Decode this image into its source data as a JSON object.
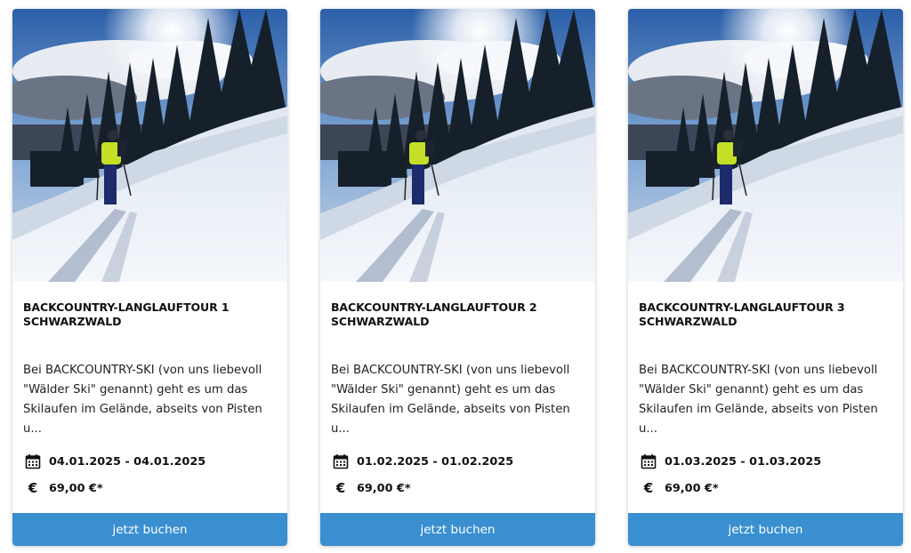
{
  "colors": {
    "button_bg": "#3a8fd0",
    "button_text": "#ffffff",
    "title_text": "#111111"
  },
  "icons": {
    "date": "calendar-icon",
    "price": "euro-icon"
  },
  "cards": [
    {
      "title": "BACKCOUNTRY-LANGLAUFTOUR 1\nSCHWARZWALD",
      "description": "Bei BACKCOUNTRY-SKI (von uns liebevoll \"Wälder Ski\" genannt) geht es um das Skilaufen im Gelände, abseits von Pisten u...",
      "date": "04.01.2025 - 04.01.2025",
      "price_symbol": "€",
      "price": "69,00 €*",
      "button": "jetzt buchen"
    },
    {
      "title": "BACKCOUNTRY-LANGLAUFTOUR 2\nSCHWARZWALD",
      "description": "Bei BACKCOUNTRY-SKI (von uns liebevoll \"Wälder Ski\" genannt) geht es um das Skilaufen im Gelände, abseits von Pisten u...",
      "date": "01.02.2025 - 01.02.2025",
      "price_symbol": "€",
      "price": "69,00 €*",
      "button": "jetzt buchen"
    },
    {
      "title": "BACKCOUNTRY-LANGLAUFTOUR 3\nSCHWARZWALD",
      "description": "Bei BACKCOUNTRY-SKI (von uns liebevoll \"Wälder Ski\" genannt) geht es um das Skilaufen im Gelände, abseits von Pisten u...",
      "date": "01.03.2025 - 01.03.2025",
      "price_symbol": "€",
      "price": "69,00 €*",
      "button": "jetzt buchen"
    }
  ]
}
